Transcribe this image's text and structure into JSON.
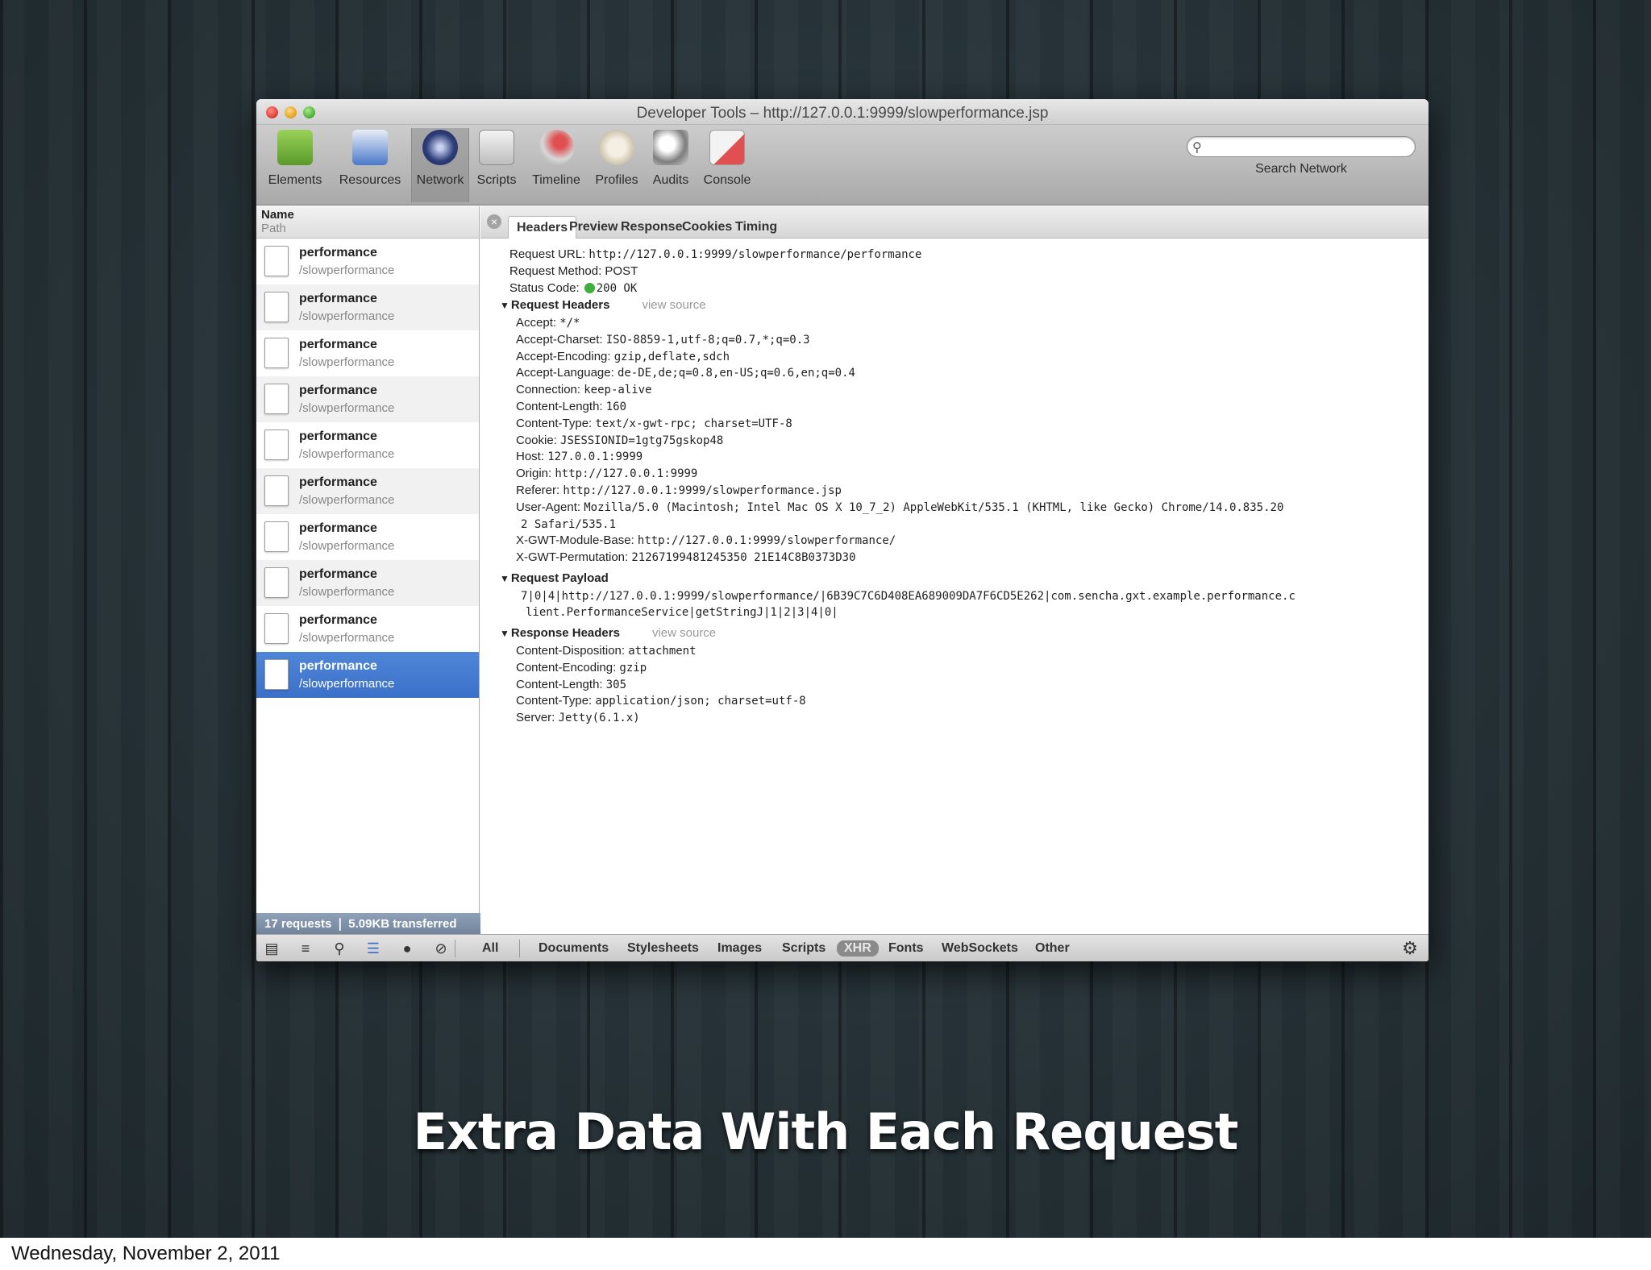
{
  "window": {
    "title": "Developer Tools – http://127.0.0.1:9999/slowperformance.jsp"
  },
  "toolbar": {
    "items": [
      {
        "label": "Elements",
        "icon": "elements-icon",
        "color": "#6fb23b"
      },
      {
        "label": "Resources",
        "icon": "resources-icon",
        "color": "#4b78c9"
      },
      {
        "label": "Network",
        "icon": "network-icon",
        "color": "#2e3e7a"
      },
      {
        "label": "Scripts",
        "icon": "scripts-icon",
        "color": "#d0d0d0"
      },
      {
        "label": "Timeline",
        "icon": "timeline-icon",
        "color": "#c43a3a"
      },
      {
        "label": "Profiles",
        "icon": "profiles-icon",
        "color": "#d9d2c0"
      },
      {
        "label": "Audits",
        "icon": "audits-icon",
        "color": "#e0e0e0"
      },
      {
        "label": "Console",
        "icon": "console-icon",
        "color": "#e05050"
      }
    ],
    "active": "Network",
    "search_placeholder": "",
    "search_label": "Search Network"
  },
  "left_pane": {
    "header_name": "Name",
    "header_path": "Path",
    "requests": [
      {
        "name": "performance",
        "path": "/slowperformance"
      },
      {
        "name": "performance",
        "path": "/slowperformance"
      },
      {
        "name": "performance",
        "path": "/slowperformance"
      },
      {
        "name": "performance",
        "path": "/slowperformance"
      },
      {
        "name": "performance",
        "path": "/slowperformance"
      },
      {
        "name": "performance",
        "path": "/slowperformance"
      },
      {
        "name": "performance",
        "path": "/slowperformance"
      },
      {
        "name": "performance",
        "path": "/slowperformance"
      },
      {
        "name": "performance",
        "path": "/slowperformance"
      },
      {
        "name": "performance",
        "path": "/slowperformance"
      }
    ],
    "selected_index": 9,
    "summary": "17 requests  ❘  5.09KB transferred"
  },
  "tabs": [
    "Headers",
    "Preview",
    "Response",
    "Cookies",
    "Timing"
  ],
  "active_tab": "Headers",
  "details": {
    "request_url_key": "Request URL:",
    "request_url": "http://127.0.0.1:9999/slowperformance/performance",
    "request_method_key": "Request Method:",
    "request_method": "POST",
    "status_code_key": "Status Code:",
    "status_code": "200 OK",
    "request_headers_title": "Request Headers",
    "view_source": "view source",
    "request_headers": [
      {
        "k": "Accept:",
        "v": "*/*"
      },
      {
        "k": "Accept-Charset:",
        "v": "ISO-8859-1,utf-8;q=0.7,*;q=0.3"
      },
      {
        "k": "Accept-Encoding:",
        "v": "gzip,deflate,sdch"
      },
      {
        "k": "Accept-Language:",
        "v": "de-DE,de;q=0.8,en-US;q=0.6,en;q=0.4"
      },
      {
        "k": "Connection:",
        "v": "keep-alive"
      },
      {
        "k": "Content-Length:",
        "v": "160"
      },
      {
        "k": "Content-Type:",
        "v": "text/x-gwt-rpc; charset=UTF-8"
      },
      {
        "k": "Cookie:",
        "v": "JSESSIONID=1gtg75gskop48"
      },
      {
        "k": "Host:",
        "v": "127.0.0.1:9999"
      },
      {
        "k": "Origin:",
        "v": "http://127.0.0.1:9999"
      },
      {
        "k": "Referer:",
        "v": "http://127.0.0.1:9999/slowperformance.jsp"
      },
      {
        "k": "User-Agent:",
        "v": "Mozilla/5.0 (Macintosh; Intel Mac OS X 10_7_2) AppleWebKit/535.1 (KHTML, like Gecko) Chrome/14.0.835.20"
      },
      {
        "k": "",
        "v": "2 Safari/535.1"
      },
      {
        "k": "X-GWT-Module-Base:",
        "v": "http://127.0.0.1:9999/slowperformance/"
      },
      {
        "k": "X-GWT-Permutation:",
        "v": "21267199481245350 21E14C8B0373D30"
      }
    ],
    "request_payload_title": "Request Payload",
    "payload_line1": "7|0|4|http://127.0.0.1:9999/slowperformance/|6B39C7C6D408EA689009DA7F6CD5E262|com.sencha.gxt.example.performance.c",
    "payload_line2": "lient.PerformanceService|getStringJ|1|2|3|4|0|",
    "response_headers_title": "Response Headers",
    "response_headers": [
      {
        "k": "Content-Disposition:",
        "v": "attachment"
      },
      {
        "k": "Content-Encoding:",
        "v": "gzip"
      },
      {
        "k": "Content-Length:",
        "v": "305"
      },
      {
        "k": "Content-Type:",
        "v": "application/json; charset=utf-8"
      },
      {
        "k": "Server:",
        "v": "Jetty(6.1.x)"
      }
    ]
  },
  "bottom_bar": {
    "filters": [
      "All",
      "Documents",
      "Stylesheets",
      "Images",
      "Scripts",
      "XHR",
      "Fonts",
      "WebSockets",
      "Other"
    ],
    "active_filter": "XHR"
  },
  "slide": {
    "title": "Extra Data With Each Request",
    "footer_date": "Wednesday, November 2, 2011"
  }
}
